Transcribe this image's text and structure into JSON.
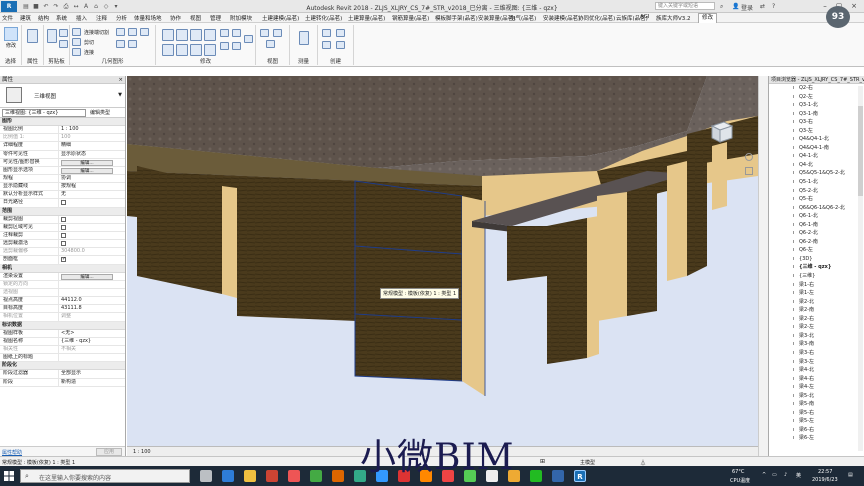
{
  "titlebar": {
    "title": "Autodesk Revit 2018 -   ZLJS_XLJRY_CS_7#_STR_v2018_已分离 - 三维视图: {三维 - qzx}",
    "search_placeholder": "键入关键字或短语",
    "user": "登录"
  },
  "menu": [
    "文件",
    "建筑",
    "结构",
    "系统",
    "插入",
    "注释",
    "分析",
    "体量和场地",
    "协作",
    "视图",
    "管理",
    "附加模块",
    "土建建模(品茗)",
    "土建转化(品茗)",
    "土建算量(品茗)",
    "钢筋算量(品茗)",
    "模板脚手架(品茗)",
    "安装算量(品茗)",
    "电气(品茗)",
    "安装建模(品茗)",
    "协同优化(品茗)",
    "云族库(品茗)",
    "AGI",
    "族库大师V3.2",
    "修改"
  ],
  "ribbon": {
    "panels": [
      "选择",
      "属性",
      "剪贴板",
      "几何图形",
      "修改",
      "视图",
      "测量",
      "创建"
    ],
    "modify_label": "修改",
    "geometry_items": [
      "连接端切割",
      "剪切",
      "连接"
    ]
  },
  "perf_badge": "93",
  "properties": {
    "header": "属性",
    "close": "×",
    "type_name": "三维视图",
    "selector_value": "三维视图: {三维 - qzx}",
    "edit_type": "编辑类型",
    "edit_btn": "编辑...",
    "rows": [
      {
        "g": "图形"
      },
      {
        "k": "视图比例",
        "v": "1 : 100"
      },
      {
        "k": "比例值 1:",
        "v": "100",
        "dim": true
      },
      {
        "k": "详细程度",
        "v": "精细"
      },
      {
        "k": "零件可见性",
        "v": "显示原状态"
      },
      {
        "k": "可见性/图形替换",
        "btn": true
      },
      {
        "k": "图形显示选项",
        "btn": true
      },
      {
        "k": "规程",
        "v": "协调"
      },
      {
        "k": "显示隐藏线",
        "v": "按规程"
      },
      {
        "k": "默认分析显示样式",
        "v": "无"
      },
      {
        "k": "日光路径",
        "cb": false
      },
      {
        "g": "范围"
      },
      {
        "k": "裁剪视图",
        "cb": false
      },
      {
        "k": "裁剪区域可见",
        "cb": false
      },
      {
        "k": "注释裁剪",
        "cb": false
      },
      {
        "k": "远剪裁激活",
        "cb": false
      },
      {
        "k": "远剪裁偏移",
        "v": "304800.0",
        "dim": true
      },
      {
        "k": "剖面框",
        "cb": true
      },
      {
        "g": "相机"
      },
      {
        "k": "渲染设置",
        "btn": true
      },
      {
        "k": "锁定的方向",
        "v": "",
        "dim": true
      },
      {
        "k": "透视图",
        "v": "",
        "dim": true
      },
      {
        "k": "视点高度",
        "v": "44112.0"
      },
      {
        "k": "目标高度",
        "v": "43111.8"
      },
      {
        "k": "相机位置",
        "v": "调整",
        "dim": true
      },
      {
        "g": "标识数据"
      },
      {
        "k": "视图样板",
        "v": "<无>"
      },
      {
        "k": "视图名称",
        "v": "{三维 - qzx}"
      },
      {
        "k": "相关性",
        "v": "不相关",
        "dim": true
      },
      {
        "k": "图纸上的标题",
        "v": ""
      },
      {
        "g": "阶段化"
      },
      {
        "k": "阶段过滤器",
        "v": "全部显示"
      },
      {
        "k": "阶段",
        "v": "新构造"
      }
    ],
    "help_link": "属性帮助",
    "apply_btn": "应用"
  },
  "viewport": {
    "tooltip": "常规模型 : 模板(依复) 1 : 类型 1",
    "scale": "1 : 100"
  },
  "browser": {
    "header": "项目浏览器 - ZLJS_XLJRY_CS_7#_STR_v2018...",
    "items": [
      "Q2-右",
      "Q2-左",
      "Q3-1-北",
      "Q3-1-南",
      "Q3-右",
      "Q3-左",
      "Q4&Q4-1-北",
      "Q4&Q4-1-南",
      "Q4-1-北",
      "Q4-北",
      "Q5&Q5-1&Q5-2-北",
      "Q5-1-北",
      "Q5-2-北",
      "Q5-右",
      "Q6&Q6-1&Q6-2-北",
      "Q6-1-北",
      "Q6-1-南",
      "Q6-2-北",
      "Q6-2-南",
      "Q6-左",
      "{3D}",
      "{三维 - qzx}",
      "{三维}",
      "梁1-右",
      "梁1-左",
      "梁2-北",
      "梁2-南",
      "梁2-右",
      "梁2-左",
      "梁3-北",
      "梁3-南",
      "梁3-右",
      "梁3-左",
      "梁4-北",
      "梁4-右",
      "梁4-左",
      "梁5-北",
      "梁5-南",
      "梁5-右",
      "梁5-左",
      "梁6-右",
      "梁6-左"
    ],
    "active_index": 21
  },
  "status": {
    "text": "常规模型 : 模板(依复) 1 : 类型 1",
    "model": "主模型"
  },
  "taskbar": {
    "search_placeholder": "在这里输入你要搜索的内容",
    "temp": "67°C",
    "cpu": "CPU温度",
    "time": "22:57",
    "date": "2019/6/23",
    "lang": "英"
  },
  "watermark": "小微BIM",
  "colors": {
    "wood": "#4a3a1c",
    "beam_side": "#e6c78a",
    "concrete": "#5a4f48",
    "select": "#1e3c8a"
  }
}
